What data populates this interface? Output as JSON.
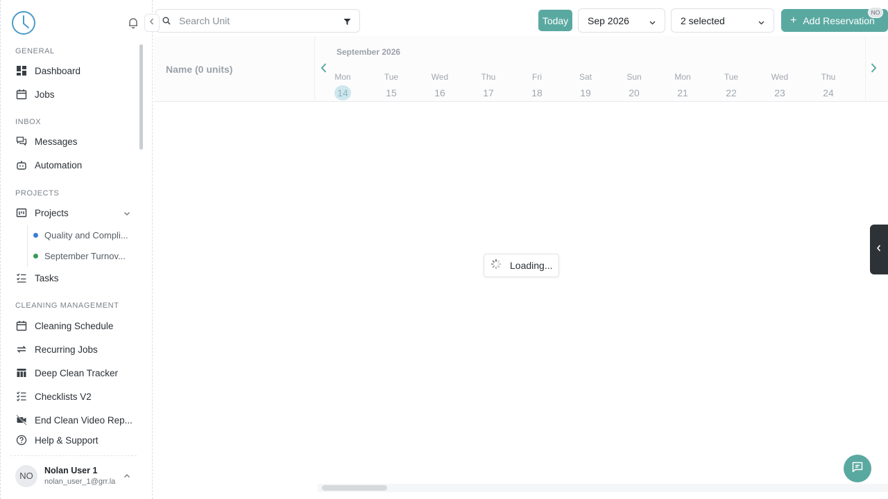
{
  "sidebar": {
    "sections": {
      "general": "GENERAL",
      "inbox": "INBOX",
      "projects": "PROJECTS",
      "cleaning": "CLEANING MANAGEMENT"
    },
    "items": {
      "dashboard": "Dashboard",
      "jobs": "Jobs",
      "messages": "Messages",
      "automation": "Automation",
      "projects": "Projects",
      "tasks": "Tasks",
      "cleaning_schedule": "Cleaning Schedule",
      "recurring_jobs": "Recurring Jobs",
      "deep_clean_tracker": "Deep Clean Tracker",
      "checklists_v2": "Checklists V2",
      "end_clean_video": "End Clean Video Rep...",
      "help_support": "Help & Support"
    },
    "sub_projects": [
      {
        "label": "Quality and Compli...",
        "color": "#3d7bd6"
      },
      {
        "label": "September Turnov...",
        "color": "#3a9a5b"
      }
    ],
    "user": {
      "initials": "NO",
      "name": "Nolan User 1",
      "email": "nolan_user_1@grr.la"
    }
  },
  "toolbar": {
    "search_placeholder": "Search Unit",
    "today_label": "Today",
    "month_select": "Sep 2026",
    "units_select": "2 selected",
    "add_label": "Add Reservation",
    "badge": "NO"
  },
  "calendar": {
    "name_header": "Name (0 units)",
    "month_label": "September 2026",
    "days": [
      {
        "name": "Mon",
        "date": "14",
        "today": true
      },
      {
        "name": "Tue",
        "date": "15"
      },
      {
        "name": "Wed",
        "date": "16"
      },
      {
        "name": "Thu",
        "date": "17"
      },
      {
        "name": "Fri",
        "date": "18"
      },
      {
        "name": "Sat",
        "date": "19"
      },
      {
        "name": "Sun",
        "date": "20"
      },
      {
        "name": "Mon",
        "date": "21"
      },
      {
        "name": "Tue",
        "date": "22"
      },
      {
        "name": "Wed",
        "date": "23"
      },
      {
        "name": "Thu",
        "date": "24"
      }
    ]
  },
  "loading_text": "Loading...",
  "colors": {
    "accent": "#5aa9a1",
    "today_bg": "#cfe7ee"
  }
}
